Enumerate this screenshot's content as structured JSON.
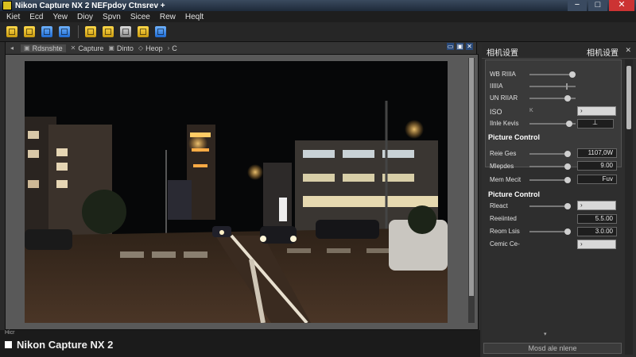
{
  "window": {
    "title": "Nikon Capture NX 2 NEFpdoy Ctnsrev +",
    "min": "−",
    "max": "□",
    "close": "✕"
  },
  "menu": [
    "Kiet",
    "Ecd",
    "Yew",
    "Dioy",
    "Spvn",
    "Sicee",
    "Rew",
    "Heqlt"
  ],
  "tabs": [
    {
      "label": "Rdsnshte"
    },
    {
      "label": "Capture"
    },
    {
      "label": "Dinto"
    },
    {
      "label": "Heop"
    },
    {
      "label": "C"
    }
  ],
  "status": {
    "small": "Hicr",
    "brand": "Nikon Capture NX 2"
  },
  "panel": {
    "title_left": "相机设置",
    "title_right": "相机设置",
    "close": "✕",
    "rows_top": [
      {
        "label": "WB RIIIA"
      },
      {
        "label": "IIIIIA"
      },
      {
        "label": "UN RIIAR"
      },
      {
        "label": "ISO"
      },
      {
        "label": "Ilnle Kevis"
      }
    ],
    "iso_small": "K",
    "section1": "Picture Control",
    "rows_mid": [
      {
        "label": "Reie Ges",
        "value": "1107,0W"
      },
      {
        "label": "Mlepdes",
        "value": "9.00"
      },
      {
        "label": "Mem Mecit",
        "value": "Fuv"
      }
    ],
    "section2": "Picture Control",
    "rows_bottom": [
      {
        "label": "Rleact"
      },
      {
        "label": "Reeiinted",
        "value": "5.5.00"
      },
      {
        "label": "Reom Lsis",
        "value": "3.0.00"
      },
      {
        "label": "Cemic Ce-"
      }
    ],
    "apply_label": "Mosd ale nlene",
    "scroll_arrow": "▾"
  }
}
